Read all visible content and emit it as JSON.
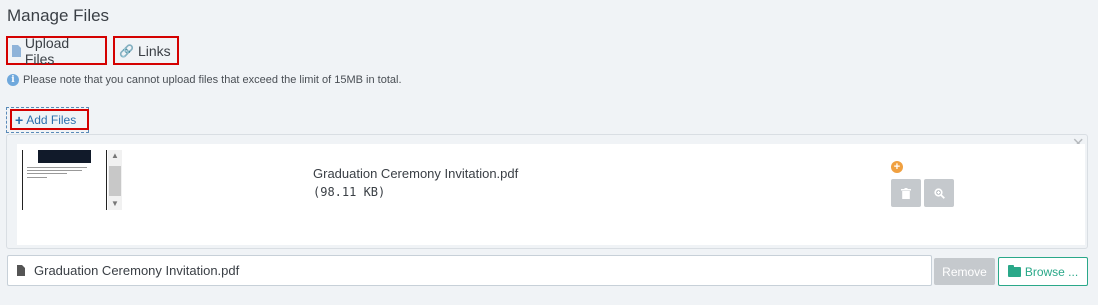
{
  "header": {
    "title": "Manage Files"
  },
  "tabs": [
    {
      "label": "Upload Files",
      "icon": "file-icon"
    },
    {
      "label": "Links",
      "icon": "link-icon"
    }
  ],
  "notice": {
    "text": "Please note that you cannot upload files that exceed the limit of 15MB in total.",
    "icon": "info-icon"
  },
  "add_files": {
    "label": "Add Files",
    "icon": "plus-icon"
  },
  "file_card": {
    "name": "Graduation Ceremony Invitation.pdf",
    "size": "(98.11 KB)"
  },
  "bottom_bar": {
    "filename": "Graduation Ceremony Invitation.pdf",
    "remove_label": "Remove",
    "browse_label": "Browse ..."
  },
  "colors": {
    "highlight": "#d40000",
    "accent_blue": "#2b6fad",
    "browse_green": "#2aa889",
    "action_gray": "#c5c9cd"
  }
}
